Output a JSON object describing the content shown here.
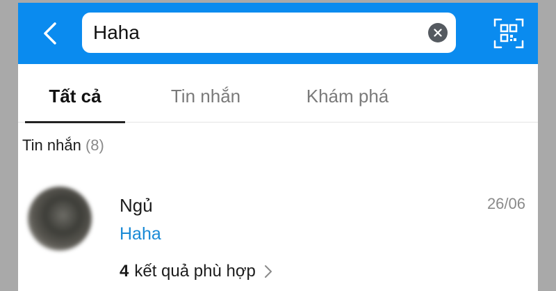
{
  "search": {
    "value": "Haha"
  },
  "tabs": [
    {
      "label": "Tất cả",
      "active": true
    },
    {
      "label": "Tin nhắn",
      "active": false
    },
    {
      "label": "Khám phá",
      "active": false
    }
  ],
  "section": {
    "title": "Tin nhắn",
    "count": "(8)"
  },
  "result": {
    "name": "Ngủ",
    "date": "26/06",
    "preview": "Haha",
    "match_number": "4",
    "match_text": "kết quả phù hợp"
  },
  "icons": {
    "back": "chevron-left-icon",
    "clear": "clear-icon",
    "qr": "qr-code-icon",
    "more": "chevron-right-icon"
  },
  "colors": {
    "header": "#0a8bef",
    "preview_link": "#1a8ad6"
  }
}
